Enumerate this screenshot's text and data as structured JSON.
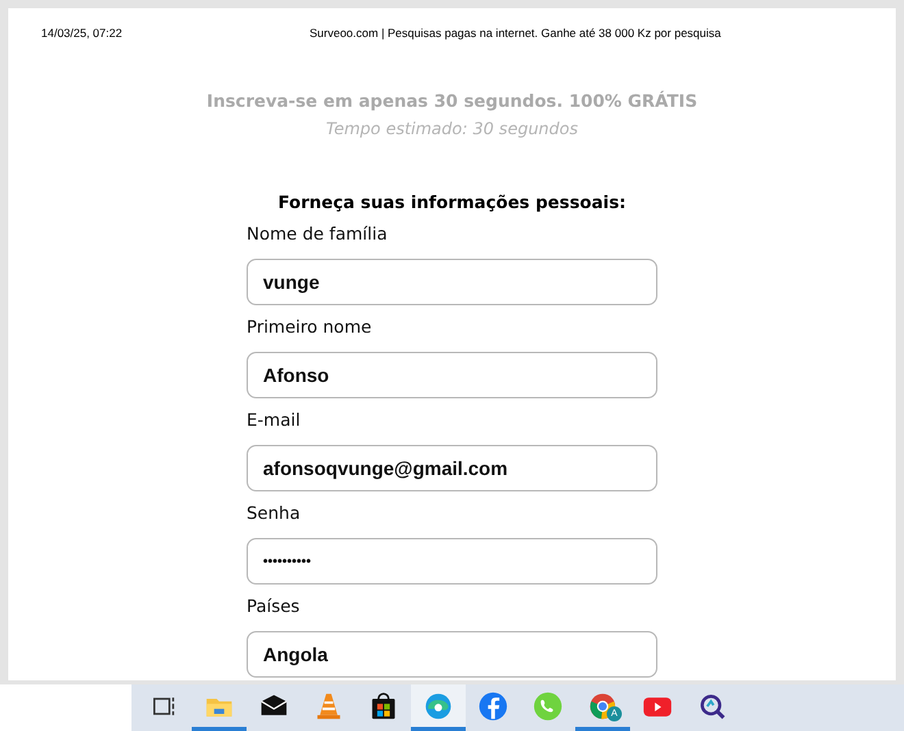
{
  "print_header": {
    "date": "14/03/25, 07:22",
    "title": "Surveoo.com | Pesquisas pagas na internet. Ganhe até 38 000 Kz por pesquisa"
  },
  "tagline": "Inscreva-se em apenas 30 segundos. 100% GRÁTIS",
  "estimate": "Tempo estimado: 30 segundos",
  "form_heading": "Forneça suas informações pessoais:",
  "fields": [
    {
      "label": "Nome de família",
      "value": "vunge"
    },
    {
      "label": "Primeiro nome",
      "value": "Afonso"
    },
    {
      "label": "E-mail",
      "value": "afonsoqvunge@gmail.com"
    },
    {
      "label": "Senha",
      "value": "••••••••••",
      "kind": "password"
    },
    {
      "label": "Países",
      "value": "Angola"
    }
  ],
  "taskbar": [
    {
      "kind": "taskview",
      "running": false,
      "active": false
    },
    {
      "kind": "folder",
      "running": true,
      "active": false
    },
    {
      "kind": "mail",
      "running": false,
      "active": false
    },
    {
      "kind": "cone",
      "running": false,
      "active": false
    },
    {
      "kind": "store",
      "running": false,
      "active": false
    },
    {
      "kind": "edge",
      "running": true,
      "active": true
    },
    {
      "kind": "facebook",
      "running": false,
      "active": false
    },
    {
      "kind": "whatsapp",
      "running": false,
      "active": false
    },
    {
      "kind": "chrome",
      "running": true,
      "active": false,
      "badge": "A"
    },
    {
      "kind": "youtube",
      "running": false,
      "active": false
    },
    {
      "kind": "magnifier",
      "running": false,
      "active": false
    }
  ]
}
